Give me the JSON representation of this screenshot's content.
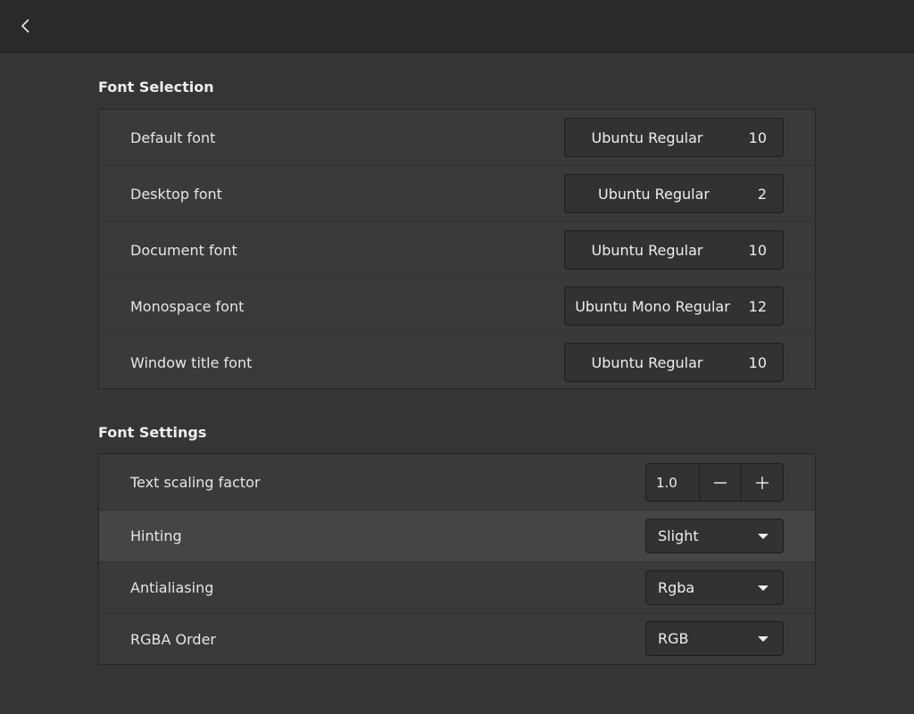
{
  "header": {
    "back_icon": "chevron-left-icon"
  },
  "font_selection": {
    "title": "Font Selection",
    "rows": [
      {
        "label": "Default font",
        "font": "Ubuntu Regular",
        "size": "10"
      },
      {
        "label": "Desktop font",
        "font": "Ubuntu Regular",
        "size": "2"
      },
      {
        "label": "Document font",
        "font": "Ubuntu Regular",
        "size": "10"
      },
      {
        "label": "Monospace font",
        "font": "Ubuntu Mono Regular",
        "size": "12"
      },
      {
        "label": "Window title font",
        "font": "Ubuntu Regular",
        "size": "10"
      }
    ]
  },
  "font_settings": {
    "title": "Font Settings",
    "scaling": {
      "label": "Text scaling factor",
      "value": "1.0",
      "minus": "−",
      "plus": "+"
    },
    "hinting": {
      "label": "Hinting",
      "value": "Slight"
    },
    "antialiasing": {
      "label": "Antialiasing",
      "value": "Rgba"
    },
    "rgba_order": {
      "label": "RGBA Order",
      "value": "RGB"
    }
  },
  "colors": {
    "background": "#353535",
    "header": "#2a2a2a",
    "frame": "#3a3a3a",
    "highlight_row": "#454545",
    "text": "#eeeeec"
  }
}
